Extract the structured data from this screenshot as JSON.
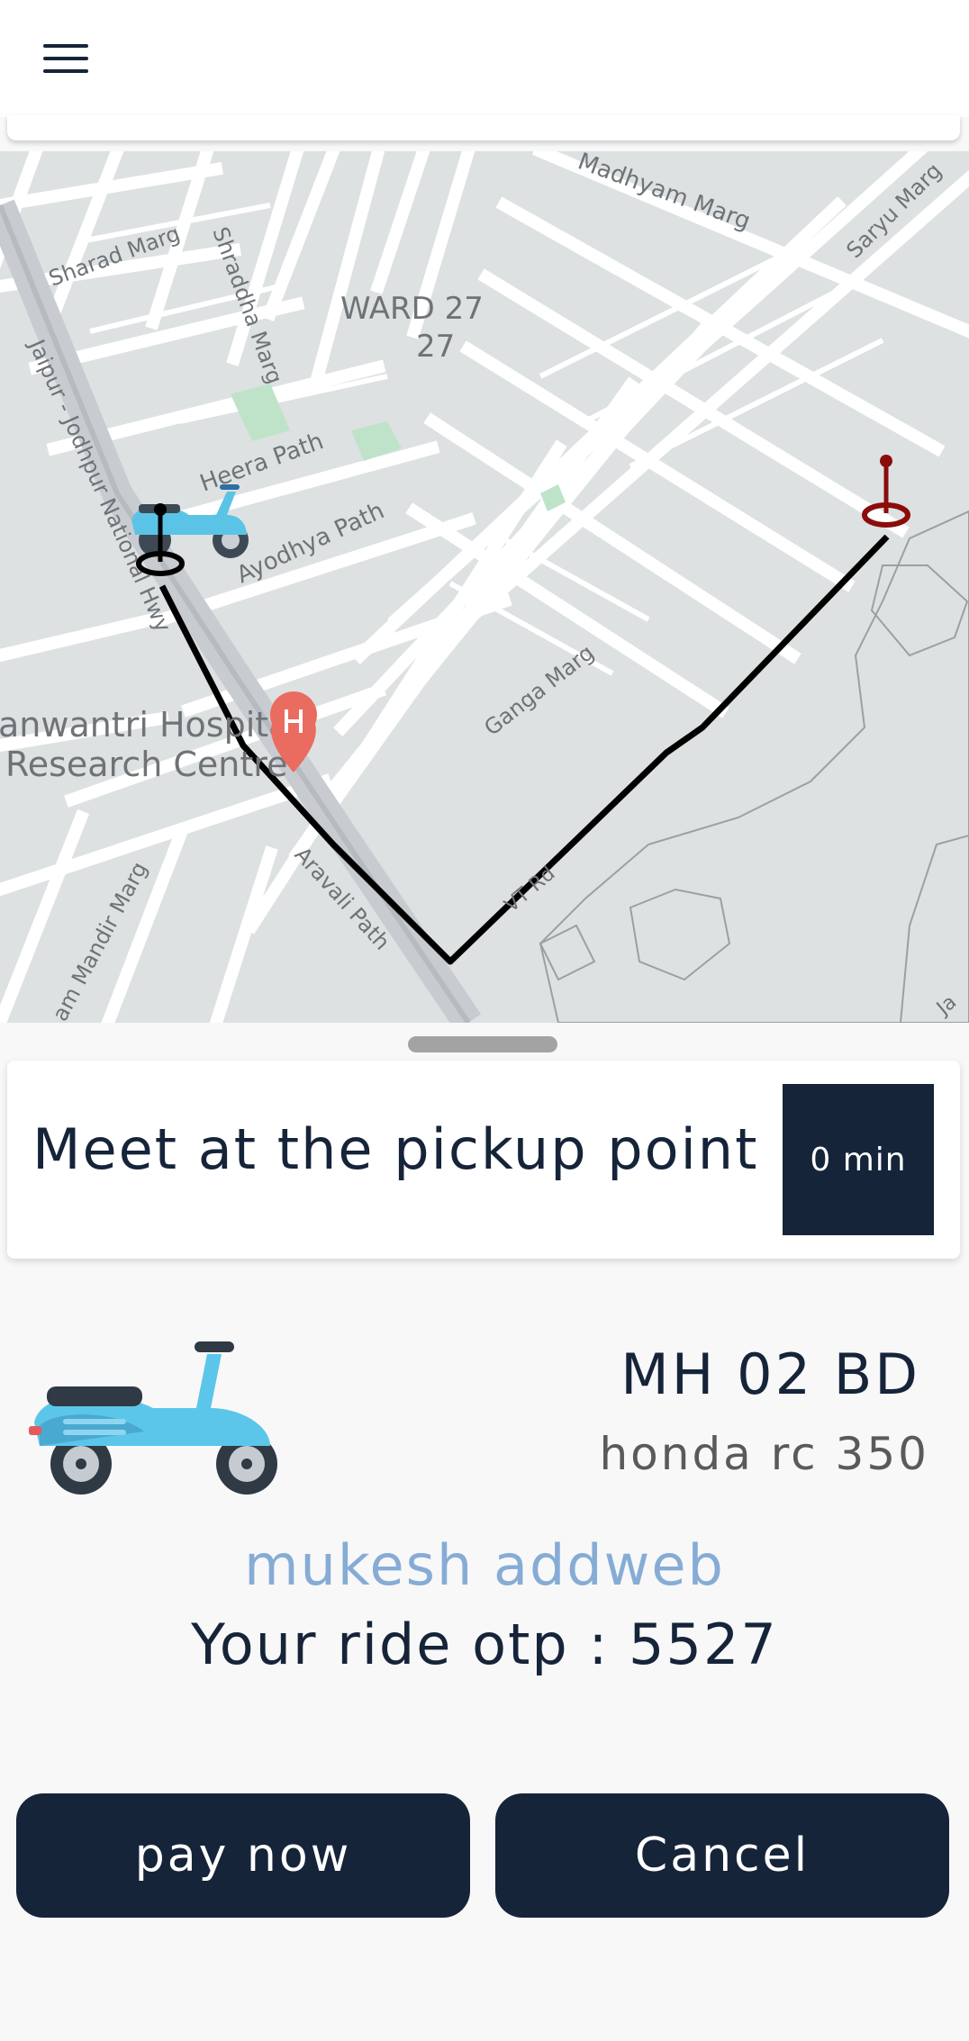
{
  "header": {
    "menu_icon": "hamburger-menu-icon"
  },
  "map": {
    "labels": {
      "madhyam_marg": "Madhyam Marg",
      "saryu_marg": "Saryu Marg",
      "sharad_marg": "Sharad Marg",
      "shraddha_marg": "Shraddha Marg",
      "ward_line1": "WARD 27",
      "ward_line2": "27",
      "jaipur_hwy": "Jaipur - Jodhpur National Hwy",
      "heera_path": "Heera Path",
      "ayodhya_path": "Ayodhya Path",
      "ganga_marg": "Ganga Marg",
      "hospital_line1": "anwantri Hospital",
      "hospital_line2": "Research Centre",
      "aravali_path": "Aravali Path",
      "vt_rd": "VT Rd",
      "mandir_marg": "am Mandir Marg",
      "edge_label": "Ja"
    },
    "icons": [
      "scooter-marker-icon",
      "pickup-pin-icon",
      "destination-pin-icon",
      "hospital-marker-icon"
    ],
    "route_color": "#000000",
    "destination_color": "#8b0c0c"
  },
  "pickup": {
    "message": "Meet at the pickup point",
    "eta": "0 min"
  },
  "vehicle": {
    "icon": "scooter-icon",
    "plate": "MH 02 BD",
    "model": "honda rc 350"
  },
  "driver": {
    "name": "mukesh addweb",
    "otp_label": "Your ride otp : ",
    "otp": "5527"
  },
  "actions": {
    "pay_label": "pay now",
    "cancel_label": "Cancel"
  },
  "colors": {
    "primary": "#16243a",
    "driver_name": "#86acd6",
    "map_background": "#dde1e2"
  }
}
